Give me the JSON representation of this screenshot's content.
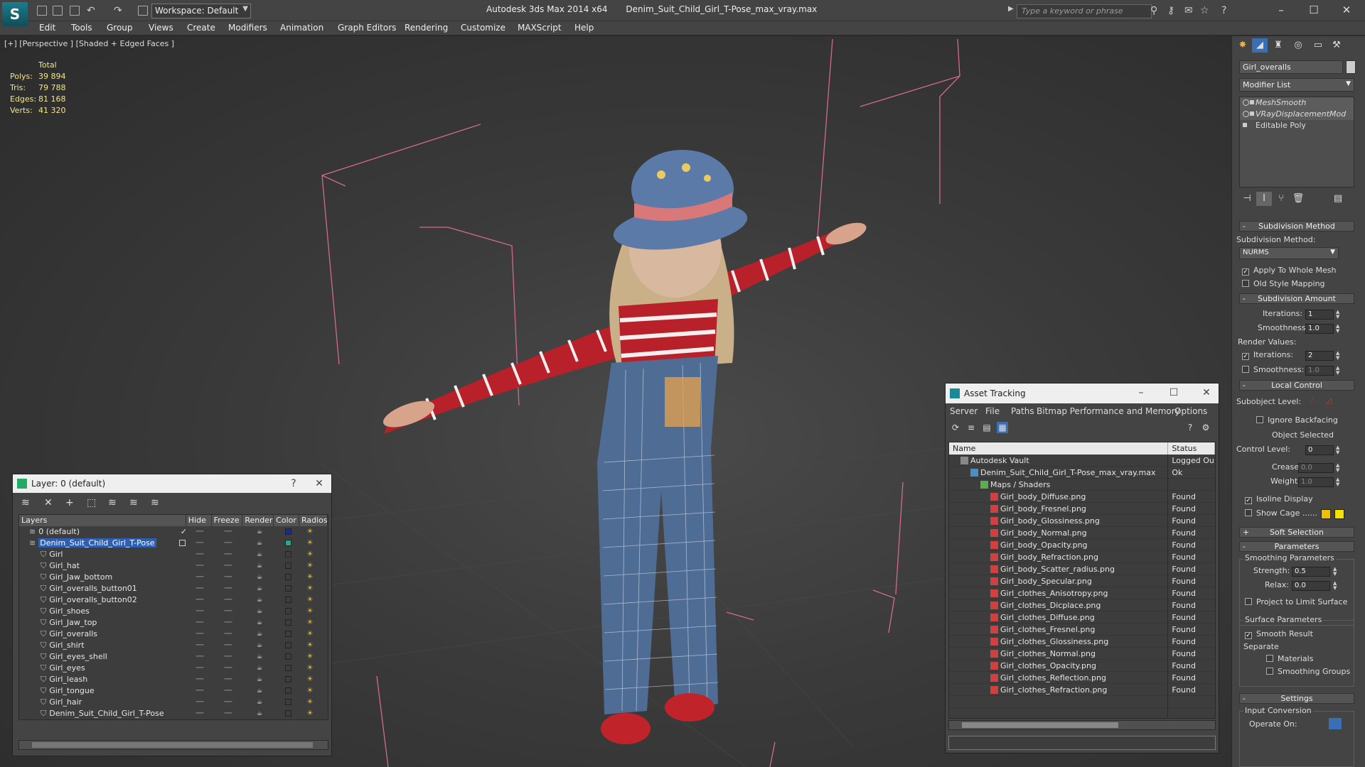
{
  "titlebar": {
    "workspace": "Workspace: Default",
    "app_title": "Autodesk 3ds Max  2014 x64",
    "file_title": "Denim_Suit_Child_Girl_T-Pose_max_vray.max",
    "search_placeholder": "Type a keyword or phrase"
  },
  "menu": [
    "Edit",
    "Tools",
    "Group",
    "Views",
    "Create",
    "Modifiers",
    "Animation",
    "Graph Editors",
    "Rendering",
    "Customize",
    "MAXScript",
    "Help"
  ],
  "viewport": {
    "label": "[+] [Perspective ] [Shaded + Edged Faces ]",
    "stats_header": "Total",
    "stats": [
      {
        "key": "Polys:",
        "value": "39 894"
      },
      {
        "key": "Tris:",
        "value": "79 788"
      },
      {
        "key": "Edges:",
        "value": "81 168"
      },
      {
        "key": "Verts:",
        "value": "41 320"
      }
    ]
  },
  "layer_dialog": {
    "title": "Layer: 0 (default)",
    "help": "?",
    "close": "✕",
    "columns": [
      "Layers",
      "Hide",
      "Freeze",
      "Render",
      "Color",
      "Radios"
    ],
    "rows": [
      {
        "name": "0 (default)",
        "indent": 1,
        "color": "#1b2a8c",
        "check": "✓"
      },
      {
        "name": "Denim_Suit_Child_Girl_T-Pose",
        "indent": 1,
        "color": "#22a88a",
        "selected": true
      },
      {
        "name": "Girl",
        "indent": 2,
        "color": "#3d3d3d"
      },
      {
        "name": "Girl_hat",
        "indent": 2,
        "color": "#3d3d3d"
      },
      {
        "name": "Girl_Jaw_bottom",
        "indent": 2,
        "color": "#3d3d3d"
      },
      {
        "name": "Girl_overalls_button01",
        "indent": 2,
        "color": "#3d3d3d"
      },
      {
        "name": "Girl_overalls_button02",
        "indent": 2,
        "color": "#3d3d3d"
      },
      {
        "name": "Girl_shoes",
        "indent": 2,
        "color": "#3d3d3d"
      },
      {
        "name": "Girl_Jaw_top",
        "indent": 2,
        "color": "#3d3d3d"
      },
      {
        "name": "Girl_overalls",
        "indent": 2,
        "color": "#3d3d3d"
      },
      {
        "name": "Girl_shirt",
        "indent": 2,
        "color": "#3d3d3d"
      },
      {
        "name": "Girl_eyes_shell",
        "indent": 2,
        "color": "#3d3d3d"
      },
      {
        "name": "Girl_eyes",
        "indent": 2,
        "color": "#3d3d3d"
      },
      {
        "name": "Girl_leash",
        "indent": 2,
        "color": "#3d3d3d"
      },
      {
        "name": "Girl_tongue",
        "indent": 2,
        "color": "#3d3d3d"
      },
      {
        "name": "Girl_hair",
        "indent": 2,
        "color": "#3d3d3d"
      },
      {
        "name": "Denim_Suit_Child_Girl_T-Pose",
        "indent": 2,
        "color": "#3d3d3d"
      }
    ]
  },
  "asset_dialog": {
    "title": "Asset Tracking",
    "menu": [
      "Server",
      "File",
      "Paths",
      "Bitmap Performance and Memory",
      "Options"
    ],
    "columns": [
      "Name",
      "Status"
    ],
    "rows": [
      {
        "name": "Autodesk Vault",
        "indent": 1,
        "status": "Logged Ou",
        "icon": "vault"
      },
      {
        "name": "Denim_Suit_Child_Girl_T-Pose_max_vray.max",
        "indent": 2,
        "status": "Ok",
        "icon": "max"
      },
      {
        "name": "Maps / Shaders",
        "indent": 3,
        "status": "",
        "icon": "maps"
      },
      {
        "name": "Girl_body_Diffuse.png",
        "indent": 4,
        "status": "Found",
        "icon": "png"
      },
      {
        "name": "Girl_body_Fresnel.png",
        "indent": 4,
        "status": "Found",
        "icon": "png"
      },
      {
        "name": "Girl_body_Glossiness.png",
        "indent": 4,
        "status": "Found",
        "icon": "png"
      },
      {
        "name": "Girl_body_Normal.png",
        "indent": 4,
        "status": "Found",
        "icon": "png"
      },
      {
        "name": "Girl_body_Opacity.png",
        "indent": 4,
        "status": "Found",
        "icon": "png"
      },
      {
        "name": "Girl_body_Refraction.png",
        "indent": 4,
        "status": "Found",
        "icon": "png"
      },
      {
        "name": "Girl_body_Scatter_radius.png",
        "indent": 4,
        "status": "Found",
        "icon": "png"
      },
      {
        "name": "Girl_body_Specular.png",
        "indent": 4,
        "status": "Found",
        "icon": "png"
      },
      {
        "name": "Girl_clothes_Anisotropy.png",
        "indent": 4,
        "status": "Found",
        "icon": "png"
      },
      {
        "name": "Girl_clothes_Dicplace.png",
        "indent": 4,
        "status": "Found",
        "icon": "png"
      },
      {
        "name": "Girl_clothes_Diffuse.png",
        "indent": 4,
        "status": "Found",
        "icon": "png"
      },
      {
        "name": "Girl_clothes_Fresnel.png",
        "indent": 4,
        "status": "Found",
        "icon": "png"
      },
      {
        "name": "Girl_clothes_Glossiness.png",
        "indent": 4,
        "status": "Found",
        "icon": "png"
      },
      {
        "name": "Girl_clothes_Normal.png",
        "indent": 4,
        "status": "Found",
        "icon": "png"
      },
      {
        "name": "Girl_clothes_Opacity.png",
        "indent": 4,
        "status": "Found",
        "icon": "png"
      },
      {
        "name": "Girl_clothes_Reflection.png",
        "indent": 4,
        "status": "Found",
        "icon": "png"
      },
      {
        "name": "Girl_clothes_Refraction.png",
        "indent": 4,
        "status": "Found",
        "icon": "png"
      }
    ]
  },
  "command_panel": {
    "object_name": "Girl_overalls",
    "modifier_list": "Modifier List",
    "stack": [
      {
        "name": "MeshSmooth",
        "italic": true
      },
      {
        "name": "VRayDisplacementMod",
        "italic": true
      },
      {
        "name": "Editable Poly",
        "italic": false
      }
    ],
    "subdivision_method_rollout": "Subdivision Method",
    "subdivision_method_label": "Subdivision Method:",
    "subdivision_method_value": "NURMS",
    "apply_whole_mesh": "Apply To Whole Mesh",
    "old_style_mapping": "Old Style Mapping",
    "subdivision_amount_rollout": "Subdivision Amount",
    "iterations_label": "Iterations:",
    "iterations_value": "1",
    "smoothness_label": "Smoothness:",
    "smoothness_value": "1.0",
    "render_values_label": "Render Values:",
    "render_iterations_value": "2",
    "render_smoothness_value": "1.0",
    "local_control_rollout": "Local Control",
    "subobject_level_label": "Subobject Level:",
    "ignore_backfacing": "Ignore Backfacing",
    "object_selected": "Object Selected",
    "control_level_label": "Control Level:",
    "control_level_value": "0",
    "crease_label": "Crease:",
    "crease_value": "0.0",
    "weight_label": "Weight:",
    "weight_value": "1.0",
    "isoline_display": "Isoline Display",
    "show_cage": "Show Cage ......",
    "soft_selection_rollout": "Soft Selection",
    "parameters_rollout": "Parameters",
    "smoothing_parameters": "Smoothing Parameters",
    "strength_label": "Strength:",
    "strength_value": "0.5",
    "relax_label": "Relax:",
    "relax_value": "0.0",
    "project_limit": "Project to Limit Surface",
    "surface_parameters": "Surface Parameters",
    "smooth_result": "Smooth Result",
    "separate_label": "Separate",
    "materials": "Materials",
    "smoothing_groups": "Smoothing Groups",
    "settings_rollout": "Settings",
    "input_conversion": "Input Conversion",
    "operate_on": "Operate On:",
    "cage_color_1": "#f0c000",
    "cage_color_2": "#f5e200"
  }
}
